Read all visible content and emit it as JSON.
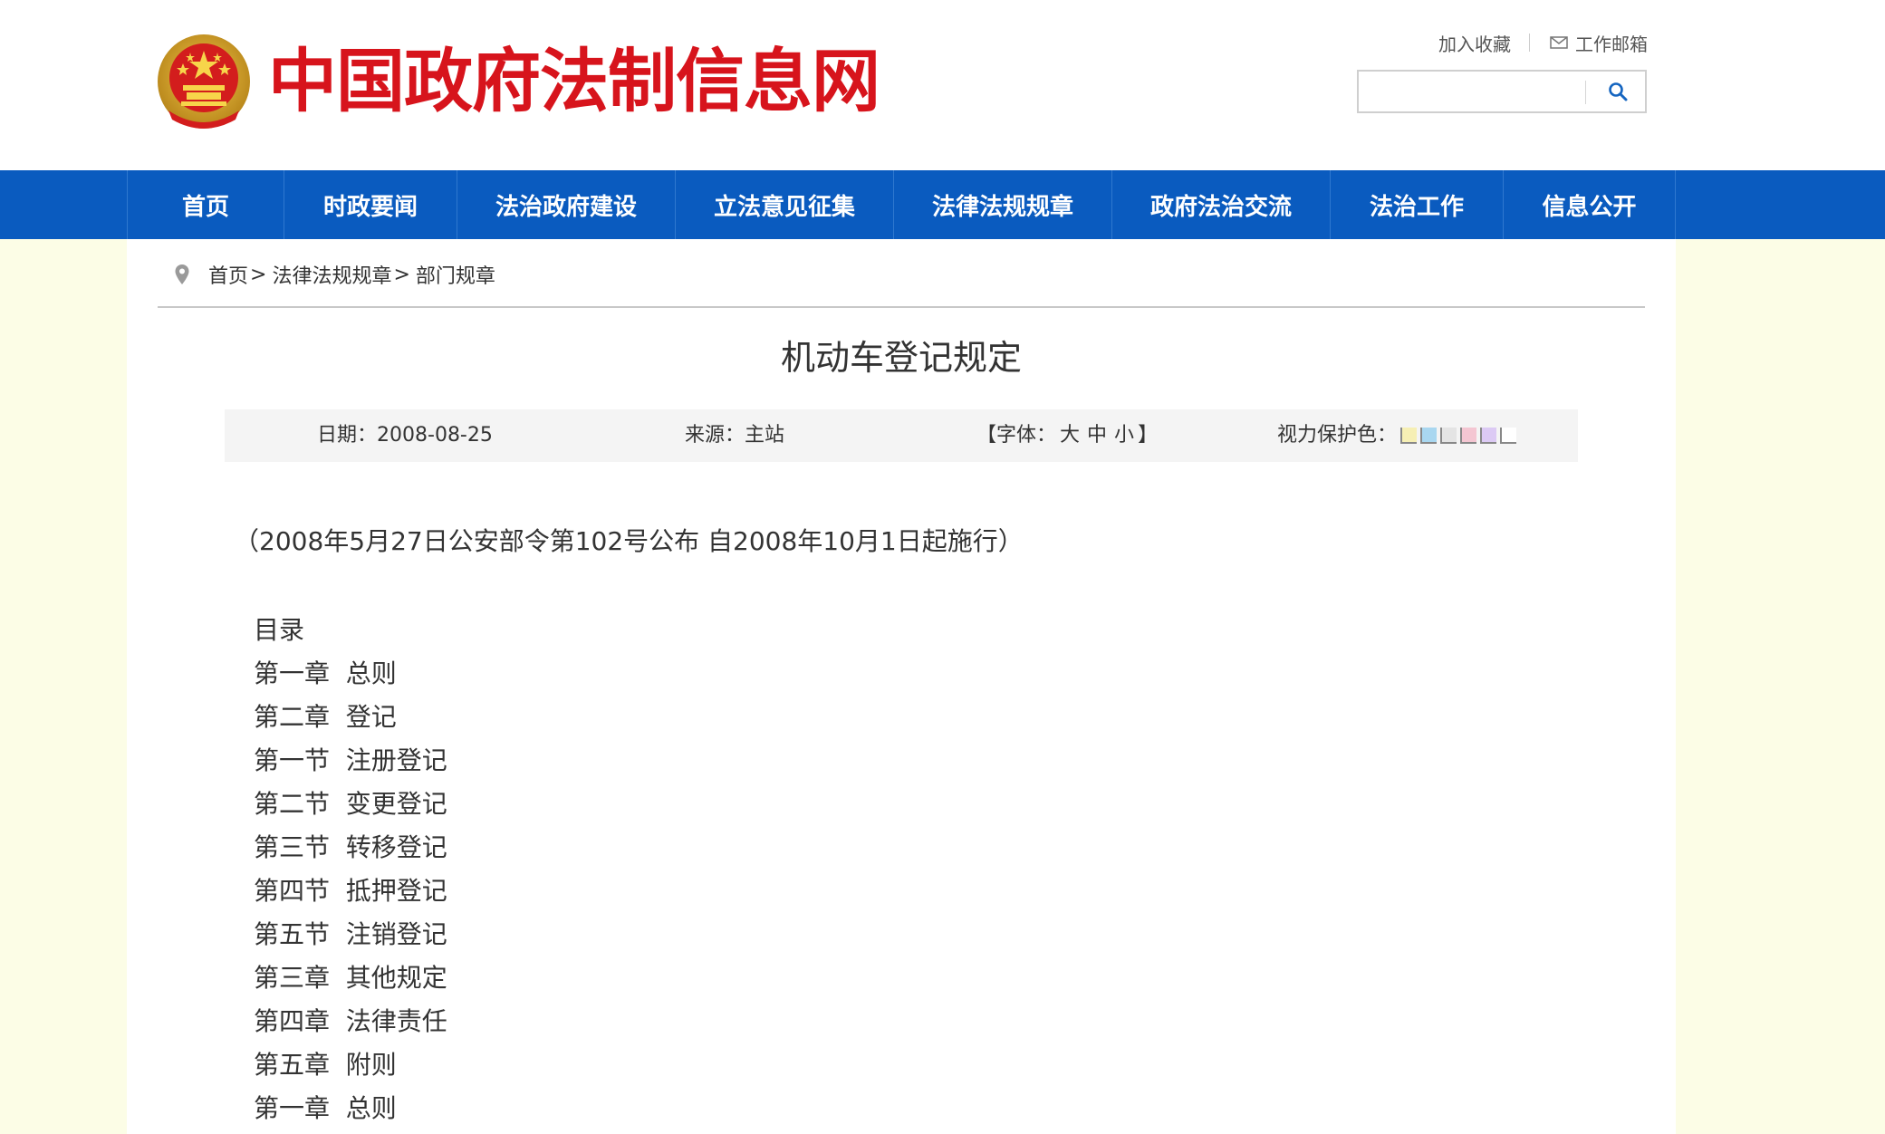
{
  "header": {
    "site_title": "中国政府法制信息网",
    "bookmark_label": "加入收藏",
    "mail_label": "工作邮箱",
    "search_placeholder": "",
    "search_icon": "search-icon",
    "title_color": "#d7141c"
  },
  "nav": {
    "background": "#0a5bbf",
    "items": [
      {
        "label": "首页"
      },
      {
        "label": "时政要闻"
      },
      {
        "label": "法治政府建设"
      },
      {
        "label": "立法意见征集"
      },
      {
        "label": "法律法规规章"
      },
      {
        "label": "政府法治交流"
      },
      {
        "label": "法治工作"
      },
      {
        "label": "信息公开"
      }
    ]
  },
  "breadcrumb": {
    "icon": "location-pin-icon",
    "items": [
      "首页",
      "法律法规规章",
      "部门规章"
    ],
    "separator": ">"
  },
  "article": {
    "title": "机动车登记规定",
    "date_label": "日期：",
    "date": "2008-08-25",
    "source_label": "来源：",
    "source": "主站",
    "font_open": "【字体：",
    "font_large": "大",
    "font_medium": "中",
    "font_small": "小",
    "font_close": "】",
    "eye_label": "视力保护色：",
    "eye_colors": [
      "#f6efb4",
      "#a9d7f0",
      "#e4e4e4",
      "#f4c6d2",
      "#dccaf4",
      "#ffffff"
    ],
    "intro": "（2008年5月27日公安部令第102号公布  自2008年10月1日起施行）",
    "toc": [
      "目录",
      "第一章  总则",
      "第二章  登记",
      "第一节  注册登记",
      "第二节  变更登记",
      "第三节  转移登记",
      "第四节  抵押登记",
      "第五节  注销登记",
      "第三章  其他规定",
      "第四章  法律责任",
      "第五章  附则",
      "第一章  总则"
    ]
  },
  "colors": {
    "side_background": "#fcfde6",
    "meta_background": "#f4f4f4"
  }
}
